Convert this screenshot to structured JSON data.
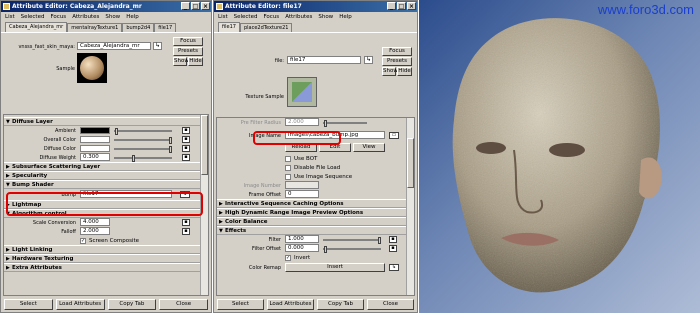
{
  "win1": {
    "title": "Attribute Editor: Cabeza_Alejandra_mr",
    "menu": [
      "List",
      "Selected",
      "Focus",
      "Attributes",
      "Show",
      "Help"
    ],
    "tabs": [
      "Cabeza_Alejandra_mr",
      "mentalrayTexture1",
      "bump2d4",
      "file17"
    ],
    "type_label": "vnsss_fast_skin_maya:",
    "name_value": "Cabeza_Alejandra_mr",
    "focus": "Focus",
    "presets": "Presets",
    "show": "Show",
    "hide": "Hide",
    "sample": "Sample",
    "diffuse_layer": "Diffuse Layer",
    "ambient": "Ambient",
    "overall_color": "Overall Color",
    "diffuse_color": "Diffuse Color",
    "diffuse_weight": "Diffuse Weight",
    "diffuse_weight_value": "0.300",
    "subsurface": "Subsurface Scattering Layer",
    "specularity": "Specularity",
    "bump_shader": "Bump Shader",
    "bump": "Bump",
    "bump_value": "file17",
    "lightmap": "Lightmap",
    "algorithm": "Algorithm control",
    "scale_conversion": "Scale Conversion",
    "scale_conversion_value": "4.000",
    "falloff": "Falloff",
    "falloff_value": "2.000",
    "screen_composite": "Screen Composite",
    "light_linking": "Light Linking",
    "hardware_texturing": "Hardware Texturing",
    "extra_attributes": "Extra Attributes",
    "bottom": [
      "Select",
      "Load Attributes",
      "Copy Tab",
      "Close"
    ]
  },
  "win2": {
    "title": "Attribute Editor: file17",
    "menu": [
      "List",
      "Selected",
      "Focus",
      "Attributes",
      "Show",
      "Help"
    ],
    "tabs": [
      "file17",
      "place2dTexture21"
    ],
    "file_label": "file:",
    "name_value": "file17",
    "focus": "Focus",
    "presets": "Presets",
    "show": "Show",
    "hide": "Hide",
    "texture_sample": "Texture Sample",
    "pre_filter_radius": "Pre Filter Radius",
    "pre_filter_value": "2.000",
    "image_name": "Image Name",
    "image_name_value": "images\\cabeza_bump.jpg",
    "reload": "Reload",
    "edit": "Edit",
    "view": "View",
    "use_bot": "Use BOT",
    "disable_file_load": "Disable File Load",
    "use_image_sequence": "Use Image Sequence",
    "image_number": "Image Number",
    "frame_offset": "Frame Offset",
    "frame_offset_value": "0",
    "interactive_sequence": "Interactive Sequence Caching Options",
    "hdr_preview": "High Dynamic Range Image Preview Options",
    "color_balance": "Color Balance",
    "effects": "Effects",
    "filter": "Filter",
    "filter_value": "1.000",
    "filter_offset": "Filter Offset",
    "filter_offset_value": "0.000",
    "invert": "Invert",
    "color_remap": "Color Remap",
    "insert": "Insert",
    "bottom": [
      "Select",
      "Load Attributes",
      "Copy Tab",
      "Close"
    ]
  },
  "viewport": {
    "watermark": "www.foro3d.com"
  },
  "colors": {
    "title_bar": "#0a246a",
    "panel": "#d4d0c8",
    "highlight": "#e00000",
    "watermark": "#1a3fd0"
  }
}
